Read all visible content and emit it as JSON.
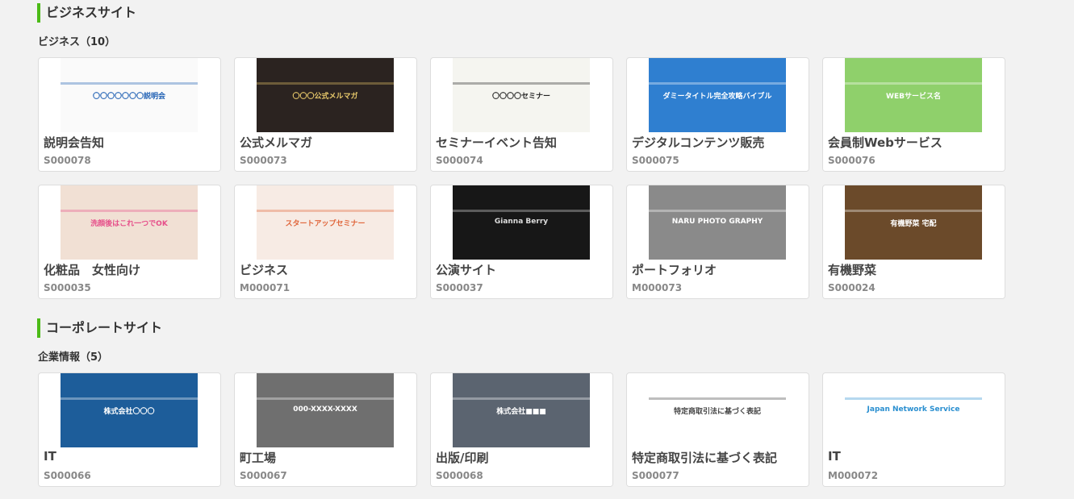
{
  "sections": [
    {
      "title": "ビジネスサイト",
      "subtitle": "ビジネス（10）",
      "cards": [
        {
          "name": "説明会告知",
          "code": "S000078",
          "thumb_bg": "#fafafa",
          "thumb_fg": "#1e5fb3",
          "thumb_text": "〇〇〇〇〇〇〇説明会"
        },
        {
          "name": "公式メルマガ",
          "code": "S000073",
          "thumb_bg": "#2b2320",
          "thumb_fg": "#e8c96b",
          "thumb_text": "〇〇〇公式メルマガ"
        },
        {
          "name": "セミナーイベント告知",
          "code": "S000074",
          "thumb_bg": "#f5f5f0",
          "thumb_fg": "#222222",
          "thumb_text": "〇〇〇〇セミナー"
        },
        {
          "name": "デジタルコンテンツ販売",
          "code": "S000075",
          "thumb_bg": "#2f7fd0",
          "thumb_fg": "#ffffff",
          "thumb_text": "ダミータイトル完全攻略バイブル"
        },
        {
          "name": "会員制Webサービス",
          "code": "S000076",
          "thumb_bg": "#8fd06b",
          "thumb_fg": "#ffffff",
          "thumb_text": "WEBサービス名"
        },
        {
          "name": "化粧品　女性向け",
          "code": "S000035",
          "thumb_bg": "#f1e0d4",
          "thumb_fg": "#e64f8a",
          "thumb_text": "洗顔後はこれ一つでOK"
        },
        {
          "name": "ビジネス",
          "code": "M000071",
          "thumb_bg": "#f7ebe4",
          "thumb_fg": "#e0653a",
          "thumb_text": "スタートアップセミナー"
        },
        {
          "name": "公演サイト",
          "code": "S000037",
          "thumb_bg": "#171717",
          "thumb_fg": "#dddddd",
          "thumb_text": "Gianna Berry"
        },
        {
          "name": "ポートフォリオ",
          "code": "M000073",
          "thumb_bg": "#8a8a8a",
          "thumb_fg": "#ffffff",
          "thumb_text": "NARU PHOTO GRAPHY"
        },
        {
          "name": "有機野菜",
          "code": "S000024",
          "thumb_bg": "#6b4a2a",
          "thumb_fg": "#ffffff",
          "thumb_text": "有機野菜 宅配"
        }
      ]
    },
    {
      "title": "コーポレートサイト",
      "subtitle": "企業情報（5）",
      "cards": [
        {
          "name": "IT",
          "code": "S000066",
          "thumb_bg": "#1d5d9a",
          "thumb_fg": "#ffffff",
          "thumb_text": "株式会社〇〇〇"
        },
        {
          "name": "町工場",
          "code": "S000067",
          "thumb_bg": "#6f6f6f",
          "thumb_fg": "#ffffff",
          "thumb_text": "000-XXXX-XXXX"
        },
        {
          "name": "出版/印刷",
          "code": "S000068",
          "thumb_bg": "#5b6470",
          "thumb_fg": "#ffffff",
          "thumb_text": "株式会社■■■"
        },
        {
          "name": "特定商取引法に基づく表記",
          "code": "S000077",
          "thumb_bg": "#ffffff",
          "thumb_fg": "#444444",
          "thumb_text": "特定商取引法に基づく表記"
        },
        {
          "name": "IT",
          "code": "M000072",
          "thumb_bg": "#ffffff",
          "thumb_fg": "#2a8fd0",
          "thumb_text": "Japan Network Service"
        }
      ]
    }
  ],
  "accent_color": "#4cbb17"
}
